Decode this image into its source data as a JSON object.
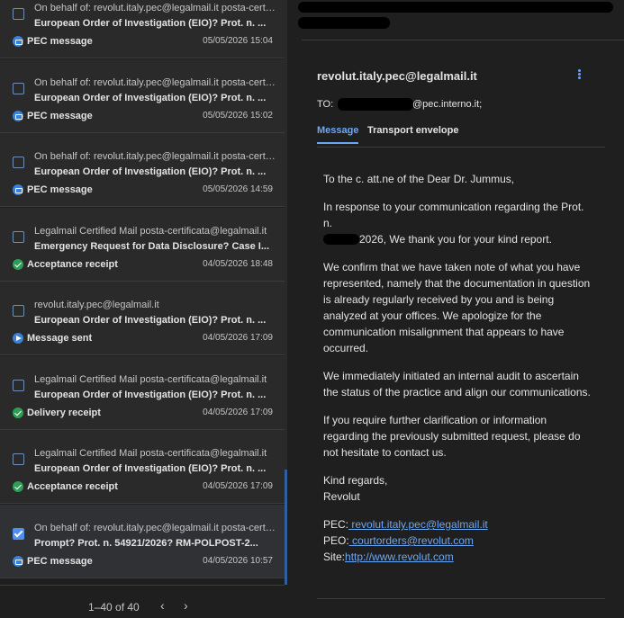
{
  "list": {
    "items": [
      {
        "from": "On behalf of: revolut.italy.pec@legalmail.it posta-certificata@legalmail.it",
        "subject": "European Order of Investigation (EIO)? Prot. n. ...",
        "kind": "PEC message",
        "kind_icon": "pec-icon",
        "date": "05/05/2026 15:04",
        "checked": false
      },
      {
        "from": "On behalf of: revolut.italy.pec@legalmail.it posta-certificata@legalmail.it",
        "subject": "European Order of Investigation (EIO)? Prot. n. ...",
        "kind": "PEC message",
        "kind_icon": "pec-icon",
        "date": "05/05/2026 15:02",
        "checked": false
      },
      {
        "from": "On behalf of: revolut.italy.pec@legalmail.it posta-certificata@legalmail.it",
        "subject": "European Order of Investigation (EIO)? Prot. n. ...",
        "kind": "PEC message",
        "kind_icon": "pec-icon",
        "date": "05/05/2026 14:59",
        "checked": false
      },
      {
        "from": "Legalmail Certified Mail posta-certificata@legalmail.it",
        "subject": "Emergency Request for Data Disclosure? Case I...",
        "kind": "Acceptance receipt",
        "kind_icon": "check-circle-icon",
        "date": "04/05/2026 18:48",
        "checked": false
      },
      {
        "from": "revolut.italy.pec@legalmail.it",
        "subject": "European Order of Investigation (EIO)? Prot. n. ...",
        "kind": "Message sent",
        "kind_icon": "send-icon",
        "date": "04/05/2026 17:09",
        "checked": false
      },
      {
        "from": "Legalmail Certified Mail posta-certificata@legalmail.it",
        "subject": "European Order of Investigation (EIO)? Prot. n. ...",
        "kind": "Delivery receipt",
        "kind_icon": "check-circle-icon",
        "date": "04/05/2026 17:09",
        "checked": false
      },
      {
        "from": "Legalmail Certified Mail posta-certificata@legalmail.it",
        "subject": "European Order of Investigation (EIO)? Prot. n. ...",
        "kind": "Acceptance receipt",
        "kind_icon": "check-circle-icon",
        "date": "04/05/2026 17:09",
        "checked": false
      },
      {
        "from": "On behalf of: revolut.italy.pec@legalmail.it posta-certificata@legalmail.it",
        "subject": "Prompt? Prot. n. 54921/2026? RM-POLPOST-2...",
        "kind": "PEC message",
        "kind_icon": "pec-icon",
        "date": "04/05/2026 10:57",
        "checked": true
      }
    ]
  },
  "pager": {
    "count": "1–40 of 40",
    "prev": "‹",
    "next": "›"
  },
  "message": {
    "sender": "revolut.italy.pec@legalmail.it",
    "to_label": "TO:",
    "to_domain": "@pec.interno.it;",
    "tabs": [
      "Message",
      "Transport envelope"
    ],
    "greeting": "To the c. att.ne of the Dear Dr. Jummus,",
    "p1_a": "In response to your communication regarding the Prot. n.",
    "p1_b": "2026, We thank you for your kind report.",
    "p2": "We confirm that we have taken note of what you have represented, namely that the documentation in question is already regularly received by you and is being analyzed at your offices. We apologize for the communication misalignment that appears to have occurred.",
    "p3": "We immediately initiated an internal audit to ascertain the status of the practice and align our communications.",
    "p4": "If you require further clarification or information regarding the previously submitted request, please do not hesitate to contact us.",
    "closing": "Kind regards,",
    "signature": "Revolut",
    "pec_label": "PEC:",
    "pec_link": " revolut.italy.pec@legalmail.it",
    "peo_label": "PEO:",
    "peo_link": " courtorders@revolut.com",
    "site_label": "Site:",
    "site_link": "http://www.revolut.com"
  },
  "colors": {
    "accent": "#6aa7f5",
    "background": "#1f1f1f",
    "row": "#2a2a2a",
    "success": "#2e9e57",
    "pec": "#3b82d6"
  }
}
